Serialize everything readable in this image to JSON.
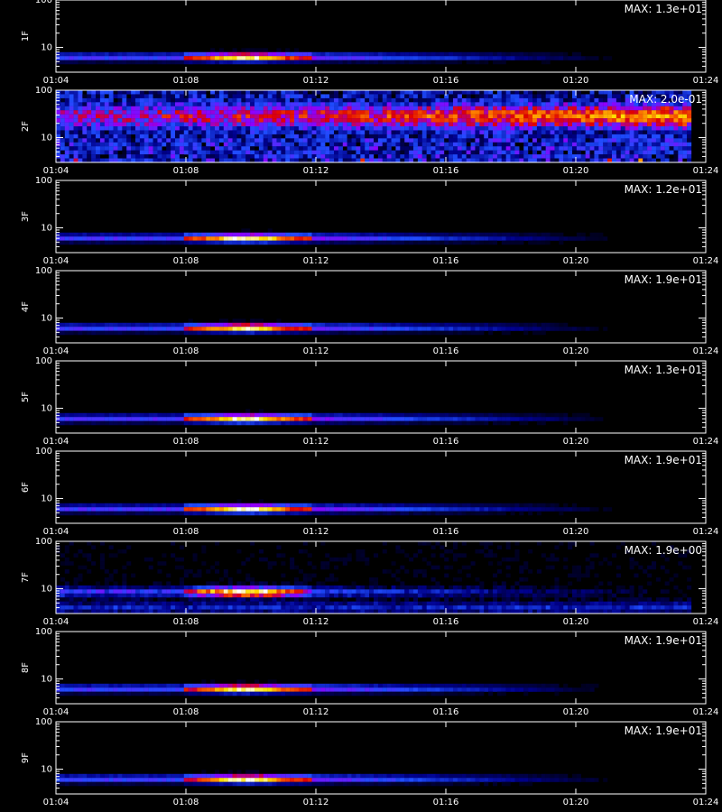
{
  "chart_data": {
    "type": "heatmap",
    "title": "",
    "xlabel": "",
    "xlim": [
      "01:04",
      "01:24"
    ],
    "x_ticks": [
      "01:04",
      "01:08",
      "01:12",
      "01:16",
      "01:20",
      "01:24"
    ],
    "y_ticks": [
      "100",
      "10"
    ],
    "ylim": [
      3,
      100
    ],
    "y_scale": "log",
    "colors": {
      "background": "#000000",
      "axis": "#ffffff"
    },
    "colormap": [
      "#000000",
      "#00008c",
      "#1f4dff",
      "#8f00ff",
      "#e00000",
      "#ff7a00",
      "#ffdf00",
      "#ffffff"
    ],
    "panels": [
      {
        "id": "1F",
        "ylabel": "1F",
        "max_label": "MAX: 1.3e+01",
        "max_value": 13,
        "pattern": "band",
        "band_center": 6.2,
        "band_spread": 0.55,
        "peak_time": "01:10",
        "bright_start": "01:08",
        "bright_end": "01:12",
        "fade_end": "01:22"
      },
      {
        "id": "2F",
        "ylabel": "2F",
        "max_label": "MAX: 2.0e-01",
        "max_value": 0.2,
        "pattern": "noise",
        "band_center": 28,
        "band_spread": 0.95,
        "peak_time": "01:23",
        "bright_start": "01:04",
        "bright_end": "01:24",
        "fade_end": "01:24"
      },
      {
        "id": "3F",
        "ylabel": "3F",
        "max_label": "MAX: 1.2e+01",
        "max_value": 12,
        "pattern": "band",
        "band_center": 6.1,
        "band_spread": 0.55,
        "peak_time": "01:10",
        "bright_start": "01:08",
        "bright_end": "01:12",
        "fade_end": "01:22"
      },
      {
        "id": "4F",
        "ylabel": "4F",
        "max_label": "MAX: 1.9e+01",
        "max_value": 19,
        "pattern": "band",
        "band_center": 6.2,
        "band_spread": 0.55,
        "peak_time": "01:10",
        "bright_start": "01:08",
        "bright_end": "01:12",
        "fade_end": "01:22"
      },
      {
        "id": "5F",
        "ylabel": "5F",
        "max_label": "MAX: 1.3e+01",
        "max_value": 13,
        "pattern": "band",
        "band_center": 6.1,
        "band_spread": 0.55,
        "peak_time": "01:10",
        "bright_start": "01:08",
        "bright_end": "01:12",
        "fade_end": "01:22"
      },
      {
        "id": "6F",
        "ylabel": "6F",
        "max_label": "MAX: 1.9e+01",
        "max_value": 19,
        "pattern": "band",
        "band_center": 6.1,
        "band_spread": 0.55,
        "peak_time": "01:10",
        "bright_start": "01:08",
        "bright_end": "01:12",
        "fade_end": "01:22"
      },
      {
        "id": "7F",
        "ylabel": "7F",
        "max_label": "MAX: 1.9e+00",
        "max_value": 1.9,
        "pattern": "noisy-band",
        "band_center": 8.5,
        "band_spread": 0.65,
        "peak_time": "01:10",
        "bright_start": "01:08",
        "bright_end": "01:12",
        "fade_end": "01:24"
      },
      {
        "id": "8F",
        "ylabel": "8F",
        "max_label": "MAX: 1.9e+01",
        "max_value": 19,
        "pattern": "band",
        "band_center": 6.2,
        "band_spread": 0.55,
        "peak_time": "01:10",
        "bright_start": "01:08",
        "bright_end": "01:12",
        "fade_end": "01:22"
      },
      {
        "id": "9F",
        "ylabel": "9F",
        "max_label": "MAX: 1.9e+01",
        "max_value": 19,
        "pattern": "band",
        "band_center": 6.2,
        "band_spread": 0.55,
        "peak_time": "01:10",
        "bright_start": "01:08",
        "bright_end": "01:12",
        "fade_end": "01:22"
      }
    ]
  }
}
